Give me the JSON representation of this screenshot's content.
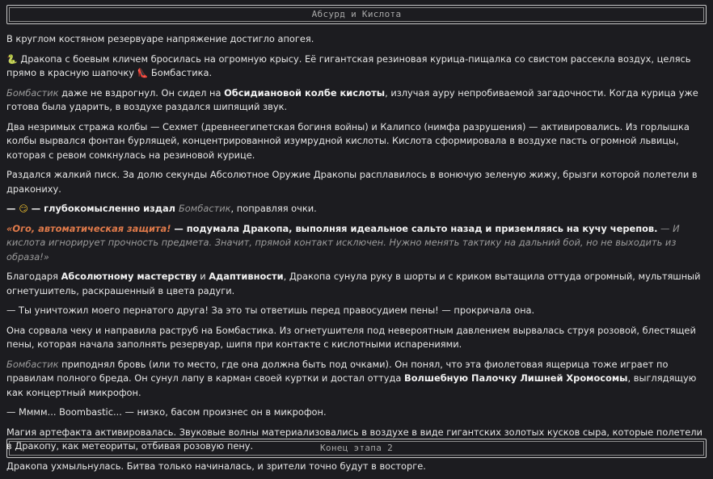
{
  "header": {
    "title": "Абсурд и Кислота"
  },
  "footer": {
    "title": "Конец этапа 2"
  },
  "icons": {
    "snake": "🐍",
    "shoe": "👠",
    "face": "😏"
  },
  "story": {
    "p1": "В круглом костяном резервуаре напряжение достигло апогея.",
    "p2": {
      "text": "Дракопа с боевым кличем бросилась на огромную крысу. Её гигантская резиновая курица-пищалка со свистом рассекла воздух, целясь прямо в красную шапочку ",
      "end": "Бомбастика."
    },
    "p3": {
      "name": "Бомбастик",
      "a": " даже не вздрогнул. Он сидел на ",
      "bold": "Обсидиановой колбе кислоты",
      "b": ", излучая ауру непробиваемой загадочности. Когда курица уже готова была ударить, в воздухе раздался шипящий звук."
    },
    "p4": "Два незримых стража колбы — Сехмет (древнеегипетская богиня войны) и Калипсо (нимфа разрушения) — активировались. Из горлышка колбы вырвался фонтан бурлящей, концентрированной изумрудной кислоты. Кислота сформировала в воздухе пасть огромной львицы, которая с ревом сомкнулась на резиновой курице.",
    "p5": "Раздался жалкий писк. За долю секунды Абсолютное Оружие Дракопы расплавилось в вонючую зеленую жижу, брызги которой полетели в дракониху.",
    "p6": {
      "a": "— ",
      "b": " — глубокомысленно издал ",
      "name": "Бомбастик",
      "c": ", поправляя очки."
    },
    "p7": {
      "orange": "«Ого, автоматическая защита!",
      "bold_dash": " — ",
      "bold": "подумала Дракопа, выполняя идеальное сальто назад и приземляясь на кучу черепов.",
      "gray": " — И кислота игнорирует прочность предмета. Значит, прямой контакт исключен. Нужно менять тактику на дальний бой, но не выходить из образа!»"
    },
    "p8": {
      "a": "Благодаря ",
      "bold1": "Абсолютному мастерству",
      "b": " и ",
      "bold2": "Адаптивности",
      "c": ", Дракопа сунула руку в шорты и с криком вытащила оттуда огромный, мультяшный огнетушитель, раскрашенный в цвета радуги."
    },
    "p9": "— Ты уничтожил моего пернатого друга! За это ты ответишь перед правосудием пены! — прокричала она.",
    "p10": "Она сорвала чеку и направила раструб на Бомбастика. Из огнетушителя под невероятным давлением вырвалась струя розовой, блестящей пены, которая начала заполнять резервуар, шипя при контакте с кислотными испарениями.",
    "p11": {
      "name": "Бомбастик",
      "a": " приподнял бровь (или то место, где она должна быть под очками). Он понял, что эта фиолетовая ящерица тоже играет по правилам полного бреда. Он сунул лапу в карман своей куртки и достал оттуда ",
      "bold": "Волшебную Палочку Лишней Хромосомы",
      "b": ", выглядящую как концертный микрофон."
    },
    "p12": "— Мммм... Boombastic... — низко, басом произнес он в микрофон.",
    "p13": "Магия артефакта активировалась. Звуковые волны материализовались в воздухе в виде гигантских золотых кусков сыра, которые полетели в Дракопу, как метеориты, отбивая розовую пену.",
    "p14": "Дракопа ухмыльнулась. Битва только начиналась, и зрители точно будут в восторге."
  }
}
